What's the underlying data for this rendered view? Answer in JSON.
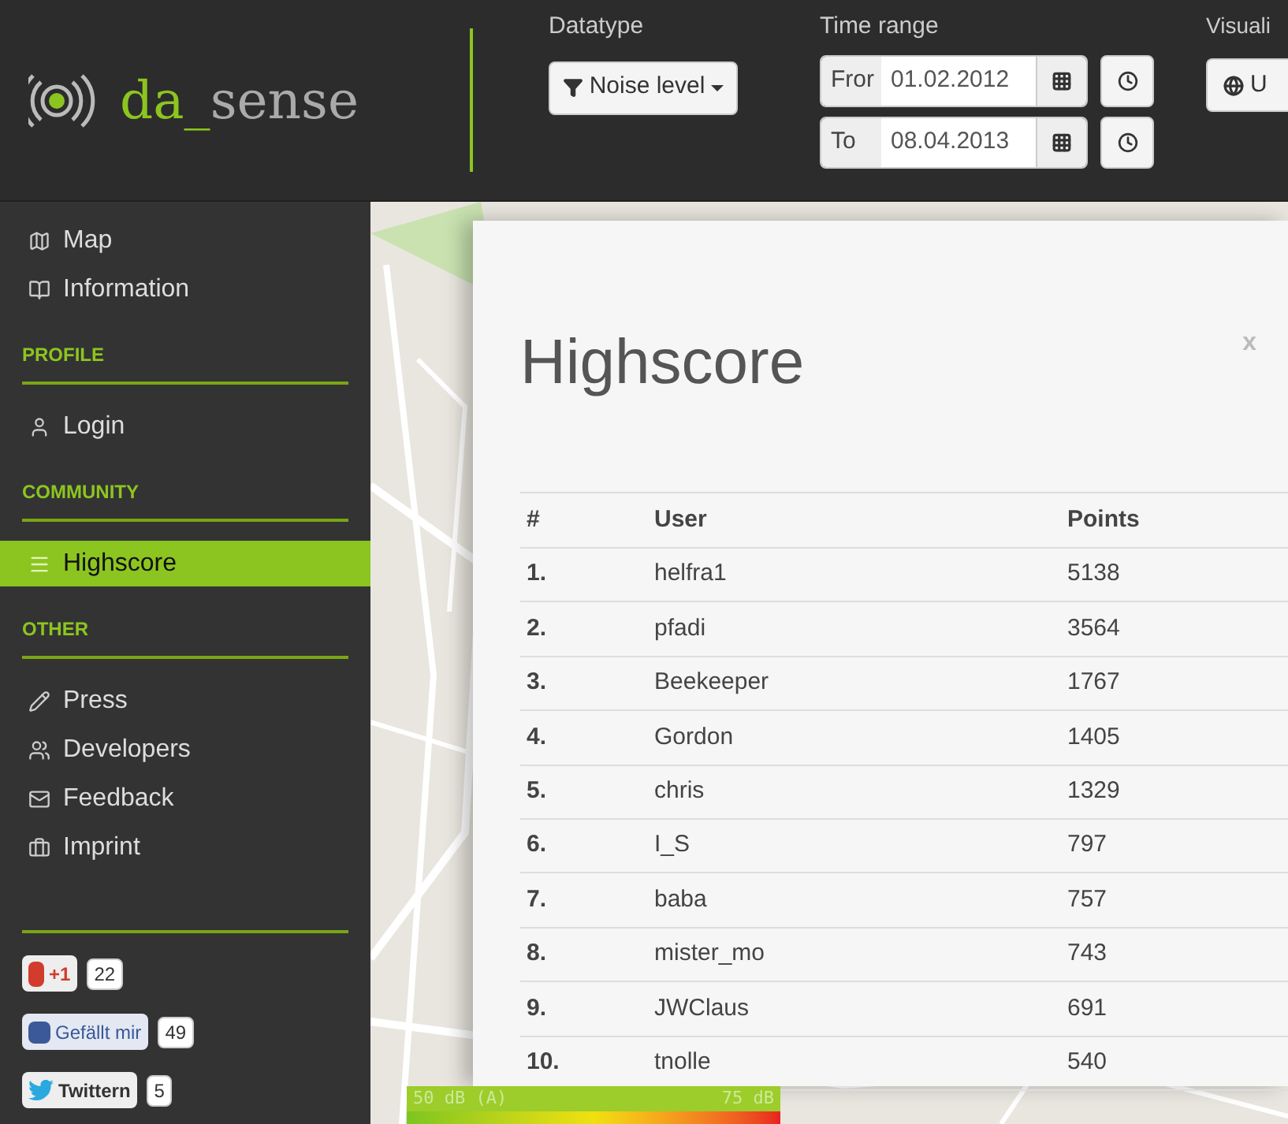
{
  "header": {
    "logo": {
      "prefix": "da_",
      "suffix": "sense"
    },
    "datatype": {
      "label": "Datatype",
      "button": "Noise level"
    },
    "time_range": {
      "label": "Time range",
      "from": {
        "label": "Fror",
        "value": "01.02.2012"
      },
      "to": {
        "label": "To",
        "value": "08.04.2013"
      }
    },
    "visualisation": {
      "label": "Visuali",
      "button": "U"
    }
  },
  "sidebar": {
    "sections": [
      {
        "items": [
          {
            "label": "Map",
            "selected": false
          },
          {
            "label": "Information",
            "selected": false
          }
        ]
      },
      {
        "heading": "PROFILE",
        "items": [
          {
            "label": "Login",
            "selected": false
          }
        ]
      },
      {
        "heading": "COMMUNITY",
        "items": [
          {
            "label": "Highscore",
            "selected": true
          }
        ]
      },
      {
        "heading": "OTHER",
        "items": [
          {
            "label": "Press",
            "selected": false
          },
          {
            "label": "Developers",
            "selected": false
          },
          {
            "label": "Feedback",
            "selected": false
          },
          {
            "label": "Imprint",
            "selected": false
          }
        ]
      }
    ],
    "social": [
      {
        "kind": "gplus",
        "label": "+1",
        "count": "22"
      },
      {
        "kind": "facebook",
        "label": "Gefällt mir",
        "count": "49"
      },
      {
        "kind": "twitter",
        "label": "Twittern",
        "count": "5"
      }
    ]
  },
  "modal": {
    "title": "Highscore",
    "close": "x",
    "columns": [
      "#",
      "User",
      "Points"
    ],
    "rows": [
      [
        "1.",
        "helfra1",
        "5138"
      ],
      [
        "2.",
        "pfadi",
        "3564"
      ],
      [
        "3.",
        "Beekeeper",
        "1767"
      ],
      [
        "4.",
        "Gordon",
        "1405"
      ],
      [
        "5.",
        "chris",
        "1329"
      ],
      [
        "6.",
        "I_S",
        "797"
      ],
      [
        "7.",
        "baba",
        "757"
      ],
      [
        "8.",
        "mister_mo",
        "743"
      ],
      [
        "9.",
        "JWClaus",
        "691"
      ],
      [
        "10.",
        "tnolle",
        "540"
      ]
    ]
  },
  "legend": {
    "min": "50 dB (A)",
    "max": "75 dB"
  }
}
